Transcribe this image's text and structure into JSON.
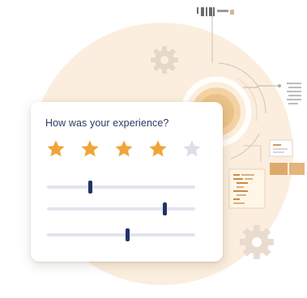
{
  "survey": {
    "question": "How was your experience?",
    "rating": 4,
    "max_rating": 5,
    "sliders": [
      {
        "value": 0.29
      },
      {
        "value": 0.79
      },
      {
        "value": 0.54
      }
    ]
  },
  "colors": {
    "star_filled": "#f0a43a",
    "star_empty": "#dcdfe5",
    "slider_thumb": "#1f3566",
    "slider_track": "#e1e5ec",
    "background_circle": "#fbeede",
    "question_text": "#2b3a64"
  },
  "decor_icons": [
    "gear-icon",
    "gear-icon",
    "code-window-icon",
    "document-icon",
    "folder-icon",
    "text-lines-icon",
    "barcode-icon"
  ]
}
